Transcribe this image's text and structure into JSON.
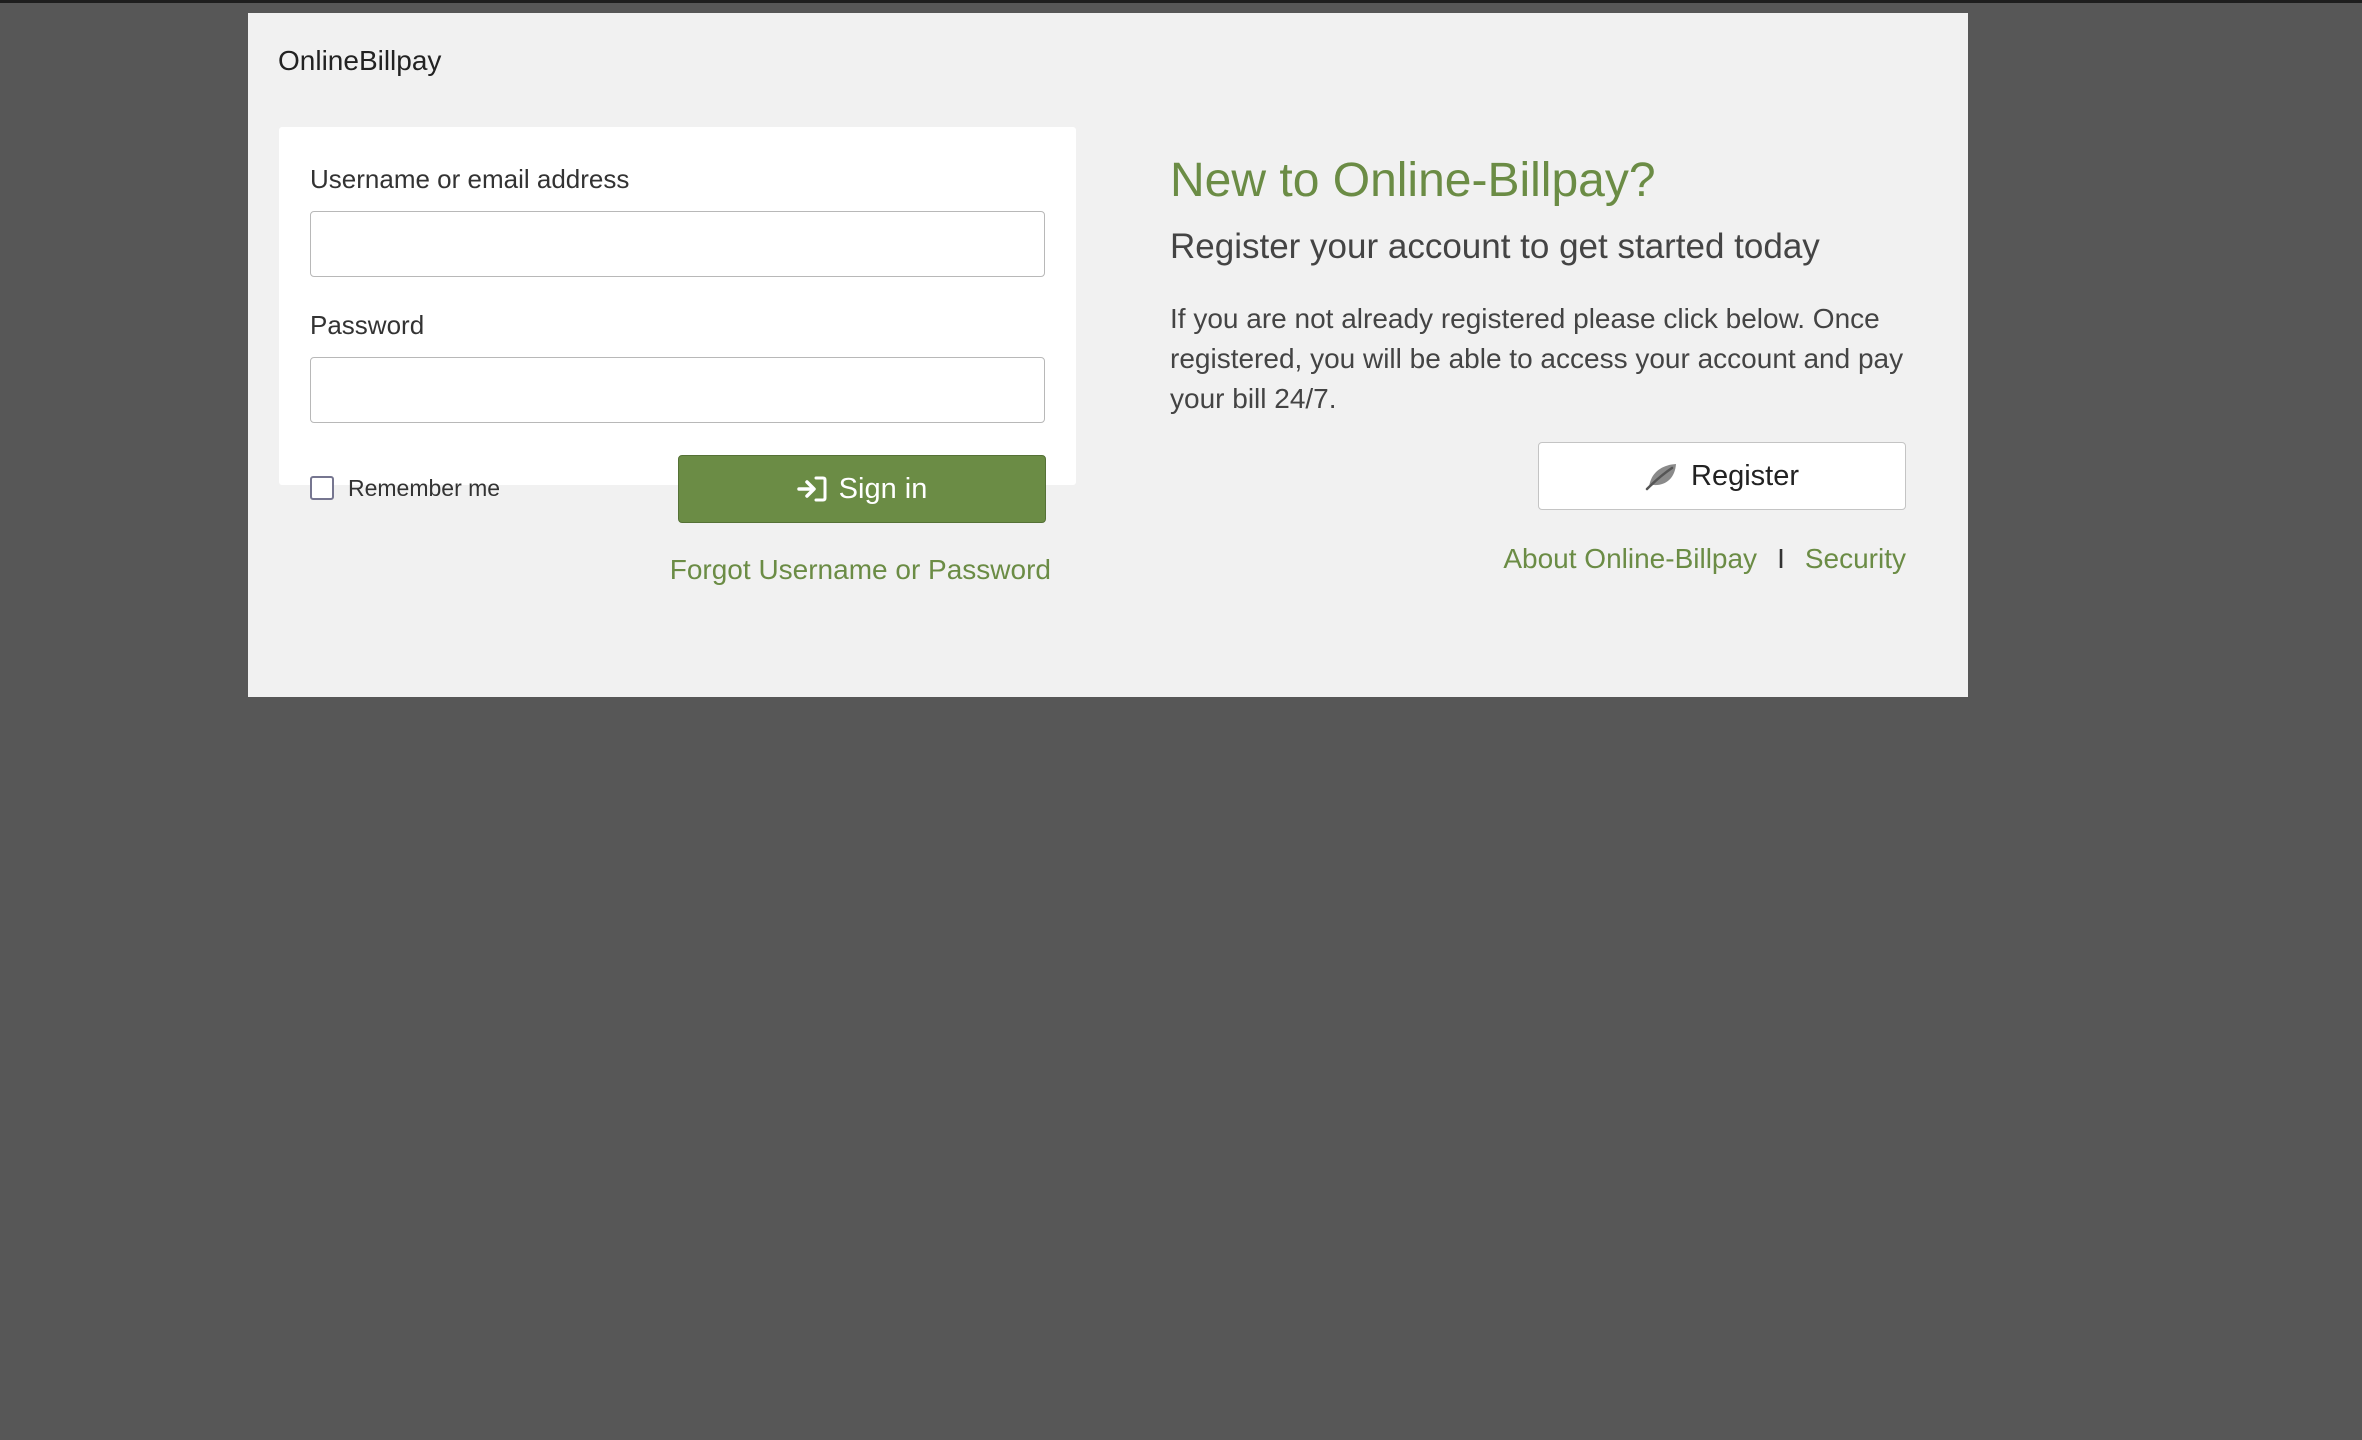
{
  "brand": {
    "name": "OnlineBillpay"
  },
  "login": {
    "username_label": "Username or email address",
    "username_value": "",
    "password_label": "Password",
    "password_value": "",
    "remember_label": "Remember me",
    "remember_checked": false,
    "signin_label": "Sign in",
    "forgot_link": "Forgot Username or Password"
  },
  "register": {
    "title": "New to Online-Billpay?",
    "subtitle": "Register your account to get started today",
    "description": "If you are not already registered please click below. Once registered, you will be able to access your account and pay your bill 24/7.",
    "button_label": "Register",
    "button_icon": "leaf-icon"
  },
  "footer": {
    "about_link": "About Online-Billpay",
    "separator": "I",
    "security_link": "Security"
  },
  "colors": {
    "accent": "#6b8c45",
    "background": "#575757",
    "panel": "#f1f1f1"
  }
}
